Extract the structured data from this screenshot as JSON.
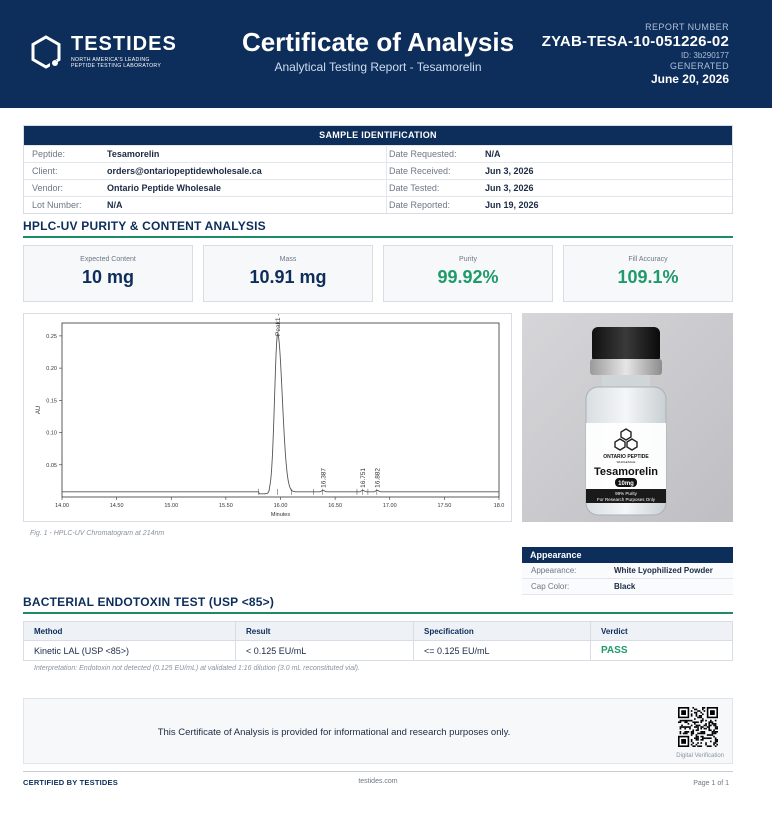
{
  "header": {
    "brand": "TESTIDES",
    "tagline_1": "NORTH AMERICA'S LEADING",
    "tagline_2": "PEPTIDE TESTING LABORATORY",
    "title": "Certificate of Analysis",
    "subtitle": "Analytical Testing Report  -  Tesamorelin",
    "report_number_label": "REPORT NUMBER",
    "report_number": "ZYAB-TESA-10-051226-02",
    "report_id": "ID: 3b290177",
    "generated_label": "GENERATED",
    "generated_date": "June 20, 2026"
  },
  "sample": {
    "title": "SAMPLE IDENTIFICATION",
    "rows": [
      {
        "label": "Peptide:",
        "value": "Tesamorelin",
        "label2": "Date Requested:",
        "value2": "N/A"
      },
      {
        "label": "Client:",
        "value": "orders@ontariopeptidewholesale.ca",
        "label2": "Date Received:",
        "value2": "Jun 3, 2026"
      },
      {
        "label": "Vendor:",
        "value": "Ontario Peptide Wholesale",
        "label2": "Date Tested:",
        "value2": "Jun 3, 2026"
      },
      {
        "label": "Lot Number:",
        "value": "N/A",
        "label2": "Date Reported:",
        "value2": "Jun 19, 2026"
      }
    ]
  },
  "hplc": {
    "section_title": "HPLC-UV PURITY & CONTENT ANALYSIS",
    "cards": [
      {
        "label": "Expected Content",
        "value": "10 mg"
      },
      {
        "label": "Mass",
        "value": "10.91 mg"
      },
      {
        "label": "Purity",
        "value": "99.92%"
      },
      {
        "label": "Fill Accuracy",
        "value": "109.1%"
      }
    ],
    "figure_caption": "Fig. 1  -  HPLC-UV Chromatogram at 214nm"
  },
  "chart_data": {
    "type": "line",
    "xlabel": "Minutes",
    "ylabel": "AU",
    "xlim": [
      14.0,
      18.0
    ],
    "ylim": [
      0.0,
      0.27
    ],
    "x_ticks": [
      "14.00",
      "14.50",
      "15.00",
      "15.50",
      "16.00",
      "16.50",
      "17.00",
      "17.50",
      "18.0"
    ],
    "y_ticks": [
      "0.05",
      "0.10",
      "0.15",
      "0.20",
      "0.25"
    ],
    "peaks": [
      {
        "label": "Peak1 - 15.974",
        "x": 15.974,
        "height": 0.245,
        "width": 0.028
      },
      {
        "label": "16.387",
        "x": 16.387,
        "height": 0.0025,
        "width": 0.01
      },
      {
        "label": "16.751",
        "x": 16.751,
        "height": 0.0025,
        "width": 0.01
      },
      {
        "label": "16.882",
        "x": 16.882,
        "height": 0.0025,
        "width": 0.01
      }
    ],
    "baseline": 0.008,
    "grid": false
  },
  "vial": {
    "brand": "ONTARIO PEPTIDE",
    "brand_sub": "WHOLESALE",
    "product": "Tesamorelin",
    "dose": "10mg",
    "purity": "99% Purity",
    "note": "For Research Purposes Only"
  },
  "appearance": {
    "title": "Appearance",
    "rows": [
      {
        "label": "Appearance:",
        "value": "White Lyophilized Powder"
      },
      {
        "label": "Cap Color:",
        "value": "Black"
      }
    ]
  },
  "endotoxin": {
    "section_title": "BACTERIAL ENDOTOXIN TEST (USP <85>)",
    "columns": [
      "Method",
      "Result",
      "Specification",
      "Verdict"
    ],
    "row": [
      "Kinetic LAL (USP <85>)",
      "< 0.125 EU/mL",
      "<= 0.125 EU/mL",
      "PASS"
    ],
    "interpretation": "Interpretation: Endotoxin not detected (0.125 EU/mL) at validated 1:16 dilution (3.0 mL reconstituted vial)."
  },
  "disclaimer": {
    "text": "This Certificate of Analysis is provided for informational and research purposes only.",
    "qr_label": "Digital Verification"
  },
  "footer": {
    "left": "CERTIFIED BY TESTIDES",
    "center": "testides.com",
    "right": "Page 1 of 1"
  },
  "colors": {
    "navy": "#0d2d5a",
    "green": "#1f9a6a",
    "accent_line": "#1f8a66"
  }
}
